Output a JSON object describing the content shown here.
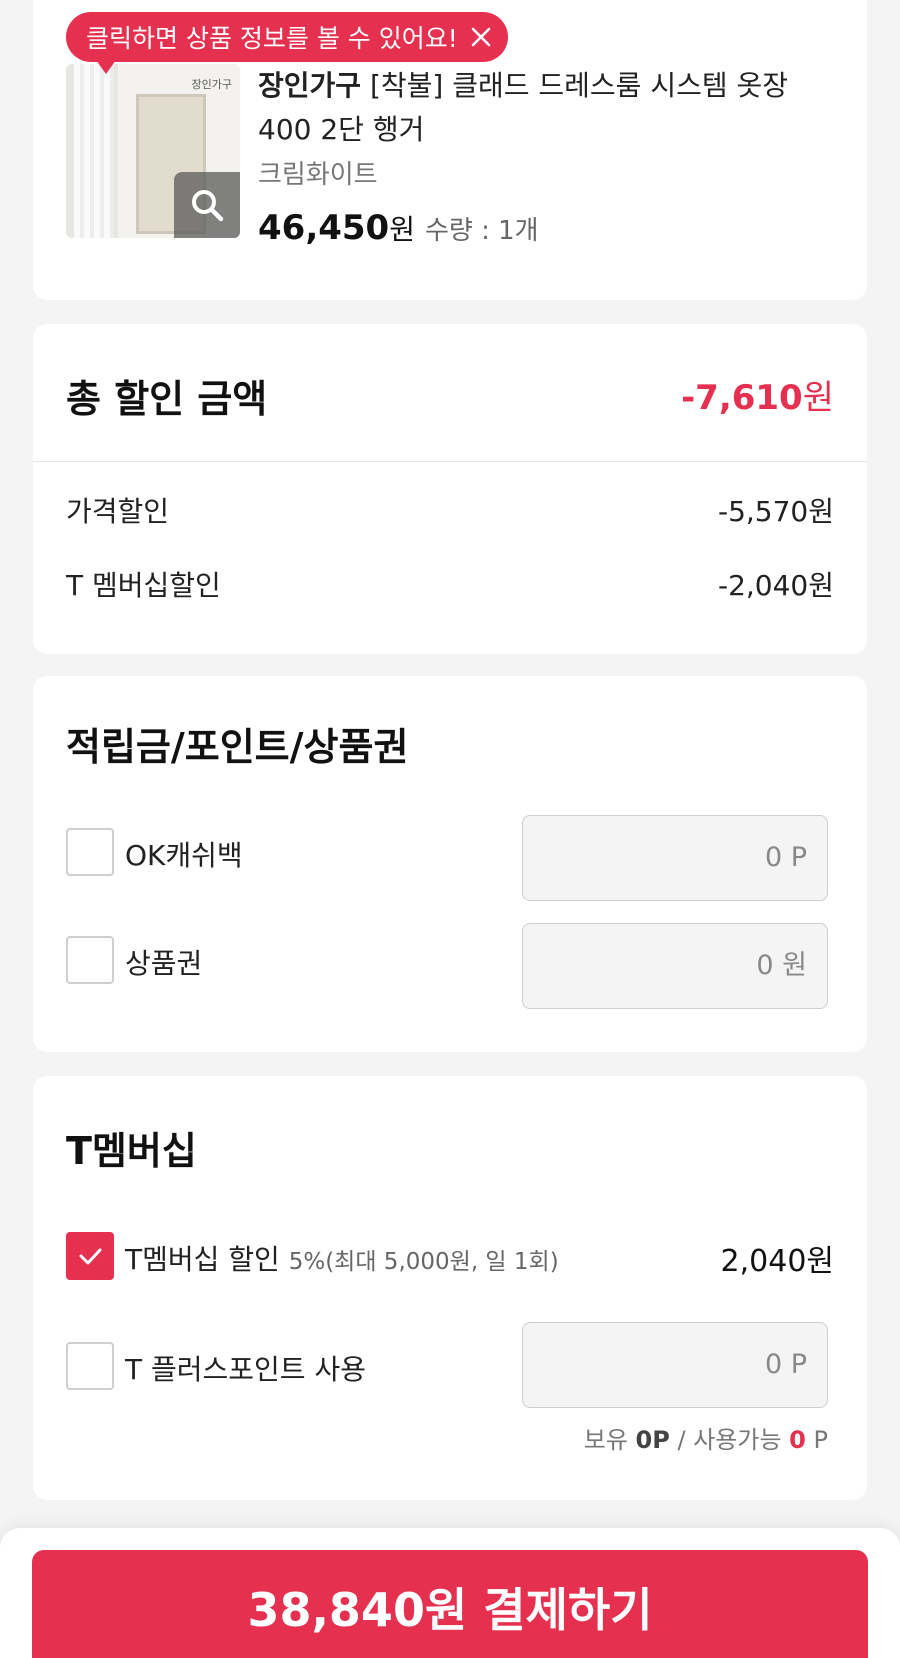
{
  "tooltip": {
    "text": "클릭하면 상품 정보를 볼 수 있어요!"
  },
  "product": {
    "thumb_brand": "장인가구",
    "brand": "장인가구",
    "title": "[착불] 클래드 드레스룸 시스템 옷장 400 2단 행거",
    "option": "크림화이트",
    "price": "46,450",
    "currency": "원",
    "quantity": "수량 : 1개"
  },
  "discount": {
    "title": "총 할인 금액",
    "total_amount": "-7,610",
    "total_currency": "원",
    "rows": [
      {
        "label": "가격할인",
        "value": "-5,570원"
      },
      {
        "label": "T 멤버십할인",
        "value": "-2,040원"
      }
    ]
  },
  "points": {
    "title": "적립금/포인트/상품권",
    "ok_cashbag": {
      "label": "OK캐쉬백",
      "value": "0  P"
    },
    "gift_card": {
      "label": "상품권",
      "value": "0  원"
    }
  },
  "membership": {
    "title": "T멤버십",
    "discount": {
      "label": "T멤버십 할인",
      "detail": "5%(최대 5,000원, 일 1회)",
      "value": "2,040원",
      "checked": true
    },
    "plus_point": {
      "label": "T 플러스포인트 사용",
      "value": "0  P"
    },
    "balance": {
      "held_label": "보유",
      "held_value": "0P",
      "available_label": "/ 사용가능",
      "available_value": "0",
      "available_unit": "P"
    }
  },
  "payment": {
    "button_label": "38,840원 결제하기"
  },
  "colors": {
    "accent": "#e5304f",
    "background": "#f4f4f4"
  }
}
